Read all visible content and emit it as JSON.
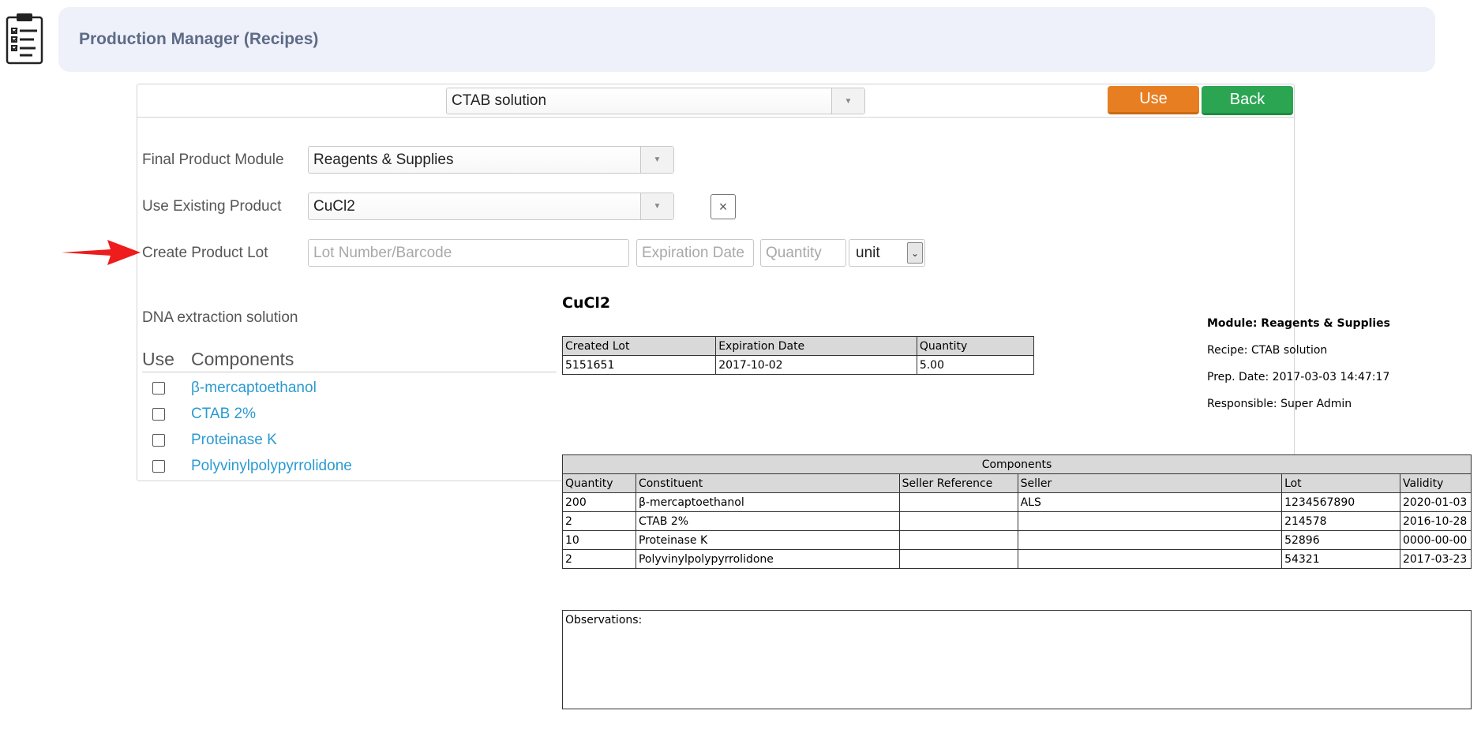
{
  "header": {
    "title": "Production Manager (Recipes)",
    "icon": "clipboard-checklist-icon"
  },
  "toolbar": {
    "recipe_selected": "CTAB solution",
    "use_label": "Use",
    "back_label": "Back",
    "use_color": "#e87e22",
    "back_color": "#2ba552"
  },
  "form": {
    "final_module_label": "Final Product Module",
    "final_module_value": "Reagents & Supplies",
    "existing_product_label": "Use Existing Product",
    "existing_product_value": "CuCl2",
    "clear_label": "×",
    "create_lot_label": "Create Product Lot",
    "lot_placeholder": "Lot Number/Barcode",
    "expiration_placeholder": "Expiration Date",
    "quantity_placeholder": "Quantity",
    "unit_value": "unit"
  },
  "recipe": {
    "description": "DNA extraction solution",
    "use_header": "Use",
    "components_header": "Components",
    "components": [
      {
        "name": "β-mercaptoethanol"
      },
      {
        "name": "CTAB 2%"
      },
      {
        "name": "Proteinase K"
      },
      {
        "name": "Polyvinylpolypyrrolidone"
      }
    ]
  },
  "report": {
    "title": "CuCl2",
    "lot_headers": [
      "Created Lot",
      "Expiration Date",
      "Quantity"
    ],
    "lot_rows": [
      [
        "5151651",
        "2017-10-02",
        "5.00"
      ]
    ],
    "info": {
      "module": "Module: Reagents & Supplies",
      "recipe": "Recipe: CTAB solution",
      "prep_date": "Prep. Date: 2017-03-03 14:47:17",
      "responsible": "Responsible: Super Admin"
    },
    "components_caption": "Components",
    "components_headers": [
      "Quantity",
      "Constituent",
      "Seller Reference",
      "Seller",
      "Lot",
      "Validity"
    ],
    "components_rows": [
      [
        "200",
        "β-mercaptoethanol",
        "",
        "ALS",
        "1234567890",
        "2020-01-03"
      ],
      [
        "2",
        "CTAB 2%",
        "",
        "",
        "214578",
        "2016-10-28"
      ],
      [
        "10",
        "Proteinase K",
        "",
        "",
        "52896",
        "0000-00-00"
      ],
      [
        "2",
        "Polyvinylpolypyrrolidone",
        "",
        "",
        "54321",
        "2017-03-23"
      ]
    ],
    "observations_label": "Observations:"
  },
  "annotation": {
    "arrow_color": "#ee1c1c"
  }
}
